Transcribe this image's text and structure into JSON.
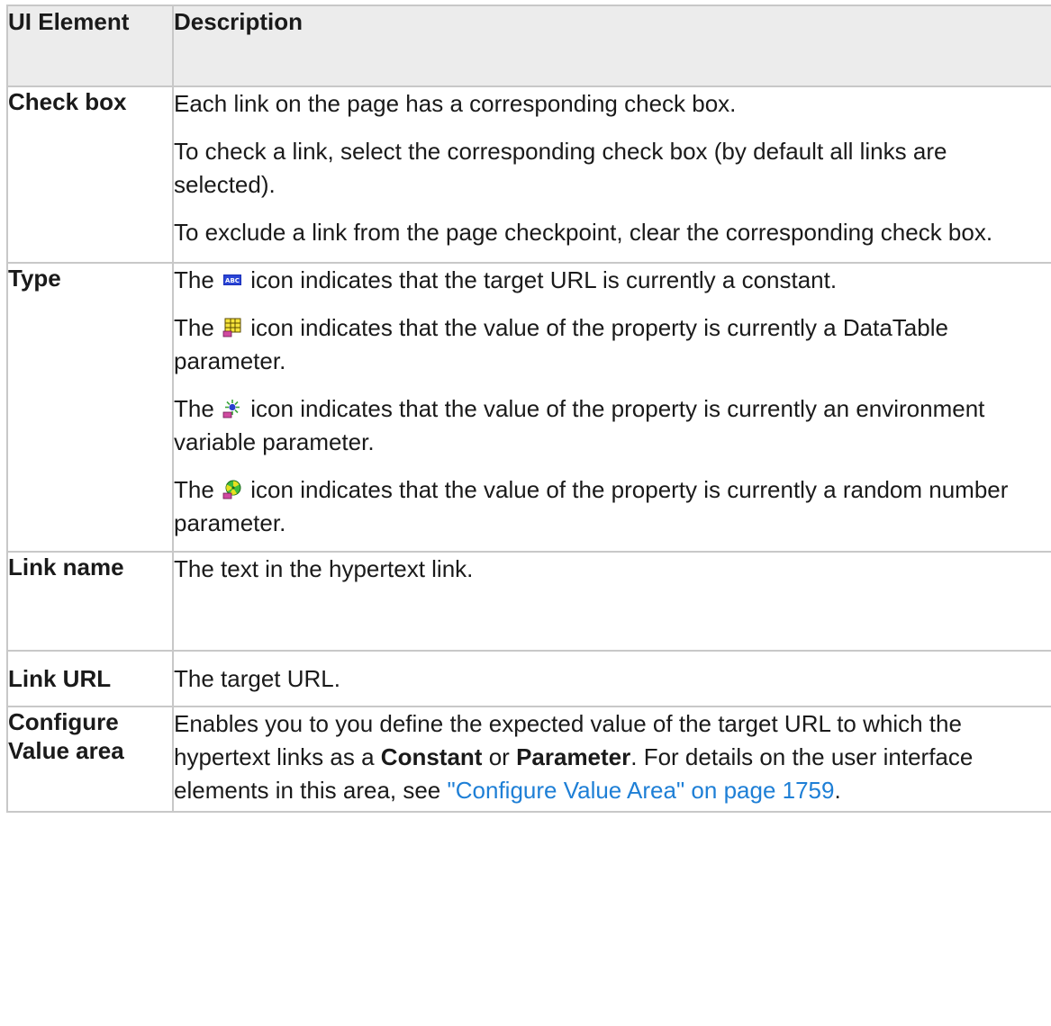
{
  "header": {
    "col1": "UI Element",
    "col2": "Description"
  },
  "rows": {
    "checkbox": {
      "name": "Check box",
      "p1": "Each link on the page has a corresponding check box.",
      "p2": "To check a link, select the corresponding check box (by default all links are selected).",
      "p3": "To exclude a link from the page checkpoint, clear the corresponding check box."
    },
    "type": {
      "name": "Type",
      "p1_pre": "The",
      "p1_post": "icon indicates that the target URL is currently a constant.",
      "p2_pre": "The",
      "p2_post": "icon indicates that the value of the property is currently a DataTable parameter.",
      "p3_pre": "The",
      "p3_post": "icon indicates that the value of the property is currently an environment variable parameter.",
      "p4_pre": "The",
      "p4_post": "icon indicates that the value of the property is currently a random number parameter."
    },
    "linkname": {
      "name": "Link name",
      "desc": "The text in the hypertext link."
    },
    "linkurl": {
      "name": "Link URL",
      "desc": "The target URL."
    },
    "config": {
      "name": "Configure Value area",
      "desc_1": "Enables you to you define the expected value of the target URL to which the hypertext links as a",
      "kw_constant": "Constant",
      "or": "or",
      "kw_parameter": "Parameter",
      "desc_2": ". For details on the user interface elements in this area, see",
      "link": "\"Configure Value Area\" on page 1759",
      "end": "."
    }
  },
  "icons": {
    "constant": "abc-constant-icon",
    "datatable": "datatable-grid-icon",
    "environment": "environment-variable-icon",
    "random": "random-number-icon"
  },
  "colors": {
    "header_bg": "#ececec",
    "border": "#c8c8c8",
    "link": "#1e7fd6"
  }
}
